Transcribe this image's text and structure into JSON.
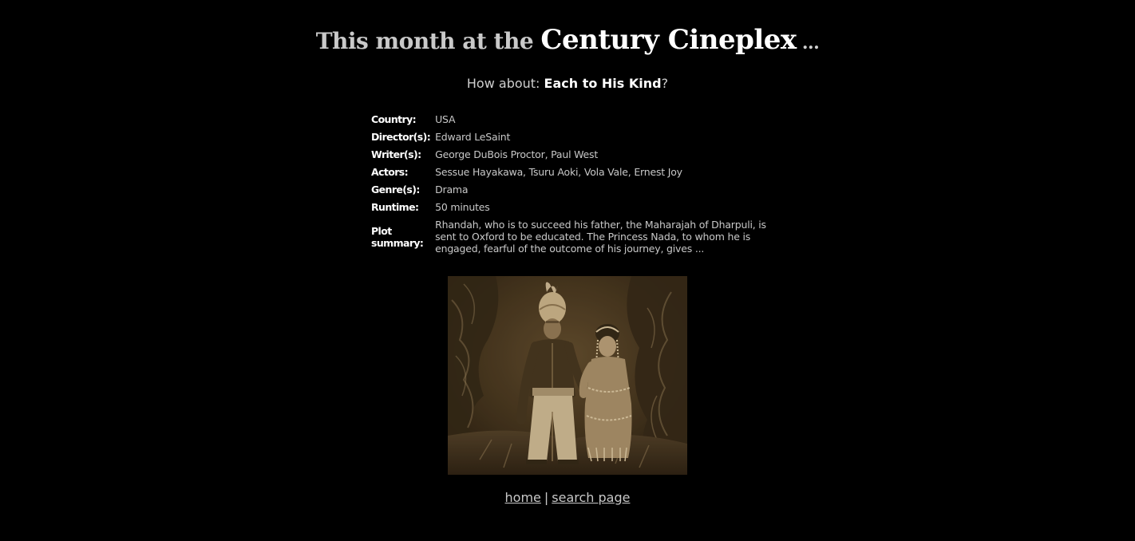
{
  "header": {
    "prefix": "This month at the ",
    "brand": "Century Cineplex",
    "suffix": " ..."
  },
  "suggestion": {
    "prefix": "How about: ",
    "movie_title": "Each to His Kind",
    "suffix": "?"
  },
  "details": [
    {
      "label": "Country:",
      "value": "USA"
    },
    {
      "label": "Director(s):",
      "value": "Edward LeSaint"
    },
    {
      "label": "Writer(s):",
      "value": "George DuBois Proctor, Paul West"
    },
    {
      "label": "Actors:",
      "value": "Sessue Hayakawa, Tsuru Aoki, Vola Vale, Ernest Joy"
    },
    {
      "label": "Genre(s):",
      "value": "Drama"
    },
    {
      "label": "Runtime:",
      "value": "50 minutes"
    },
    {
      "label": "Plot summary:",
      "value": "Rhandah, who is to succeed his father, the Maharajah of Dharpuli, is sent to Oxford to be educated. The Princess Nada, to whom he is engaged, fearful of the outcome of his journey, gives ..."
    }
  ],
  "poster": {
    "caption": "",
    "palette": {
      "shadow": "#1e150b",
      "mid": "#4a3a24",
      "light": "#a89370",
      "highlight": "#d9c7a3"
    }
  },
  "footer": {
    "home_label": "home",
    "separator": "|",
    "search_label": "search page"
  },
  "colors": {
    "background": "#000000",
    "text": "#c8c8c8",
    "emphasis": "#ffffff"
  }
}
